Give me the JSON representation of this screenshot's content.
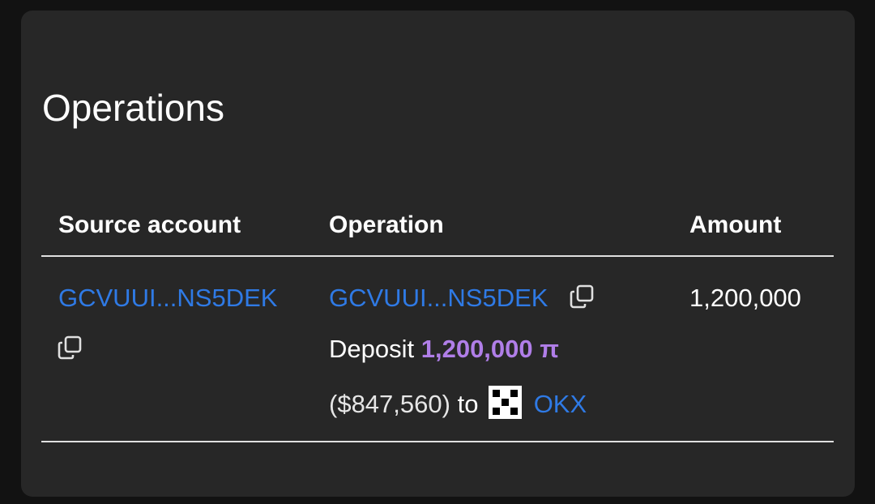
{
  "section": {
    "title": "Operations"
  },
  "table": {
    "headers": [
      "Source account",
      "Operation",
      "Amount"
    ],
    "rows": [
      {
        "source_account": "GCVUUI...NS5DEK",
        "operation_account": "GCVUUI...NS5DEK",
        "operation_type": "Deposit",
        "pi_amount": "1,200,000 π",
        "usd_value": "($847,560)",
        "connector": "to",
        "destination": "OKX",
        "amount": "1,200,000"
      }
    ]
  },
  "colors": {
    "background": "#121212",
    "card": "#272727",
    "link": "#2f7ae5",
    "pi_amount": "#b07ee8",
    "text": "#ffffff"
  },
  "icons": {
    "copy": "copy-icon",
    "exchange_logo": "okx-logo"
  }
}
